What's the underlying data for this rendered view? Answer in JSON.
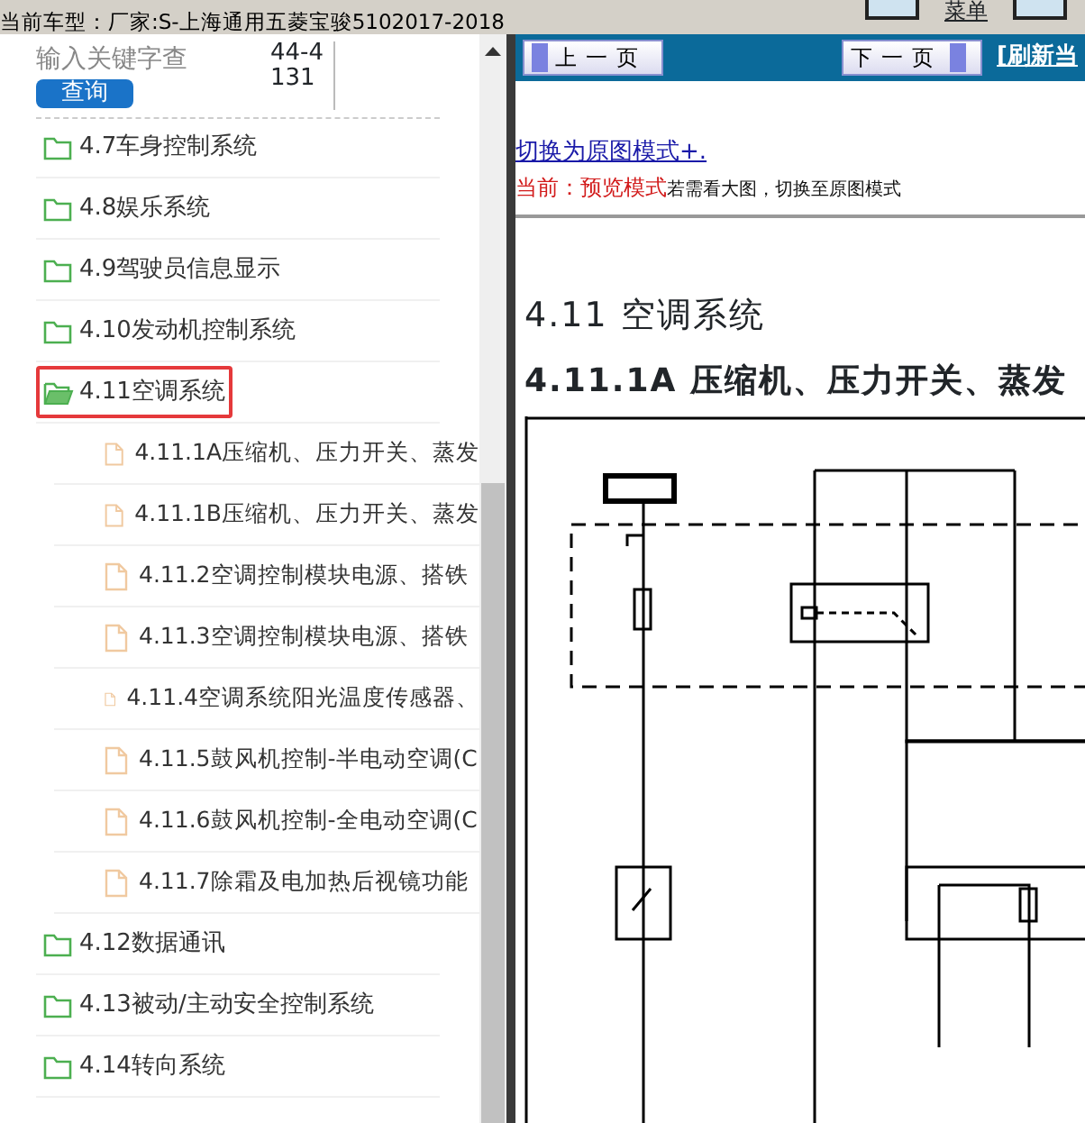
{
  "header": {
    "vehicle": "当前车型：厂家:S-上海通用五菱宝骏5102017-2018",
    "menu_label": "菜单"
  },
  "search": {
    "placeholder": "输入关键字查",
    "button": "查询",
    "code": "44-4131"
  },
  "tree": [
    {
      "label": "4.7车身控制系统",
      "expanded": false,
      "selected": false
    },
    {
      "label": "4.8娱乐系统",
      "expanded": false,
      "selected": false
    },
    {
      "label": "4.9驾驶员信息显示",
      "expanded": false,
      "selected": false
    },
    {
      "label": "4.10发动机控制系统",
      "expanded": false,
      "selected": false
    },
    {
      "label": "4.11空调系统",
      "expanded": true,
      "selected": true,
      "children": [
        {
          "label": "4.11.1A压缩机、压力开关、蒸发"
        },
        {
          "label": "4.11.1B压缩机、压力开关、蒸发"
        },
        {
          "label": "4.11.2空调控制模块电源、搭铁"
        },
        {
          "label": "4.11.3空调控制模块电源、搭铁"
        },
        {
          "label": "4.11.4空调系统阳光温度传感器、"
        },
        {
          "label": "4.11.5鼓风机控制-半电动空调(C"
        },
        {
          "label": "4.11.6鼓风机控制-全电动空调(C"
        },
        {
          "label": "4.11.7除霜及电加热后视镜功能"
        }
      ]
    },
    {
      "label": "4.12数据通讯",
      "expanded": false,
      "selected": false
    },
    {
      "label": "4.13被动/主动安全控制系统",
      "expanded": false,
      "selected": false
    },
    {
      "label": "4.14转向系统",
      "expanded": false,
      "selected": false
    }
  ],
  "viewer": {
    "prev_button": "上一页",
    "next_button": "下一页",
    "refresh_link": "[刷新当",
    "mode_link": "切换为原图模式+.",
    "mode_status": "当前：预览模式",
    "mode_hint": "若需看大图，切换至原图模式",
    "section_title": "4.11 空调系统",
    "subsection_title": "4.11.1A 压缩机、压力开关、蒸发"
  }
}
